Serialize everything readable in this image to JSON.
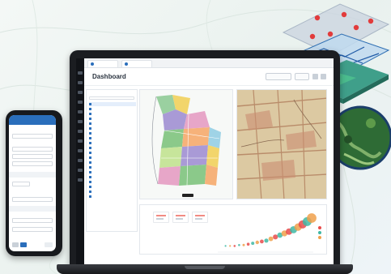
{
  "app": {
    "title": "Dashboard",
    "tabs": [
      "",
      ""
    ],
    "header_buttons": [
      "",
      ""
    ]
  },
  "layers_panel": {
    "title": "",
    "items": [
      "",
      "",
      "",
      "",
      "",
      "",
      "",
      "",
      "",
      "",
      "",
      "",
      "",
      "",
      "",
      "",
      "",
      "",
      "",
      ""
    ]
  },
  "chart": {
    "title": ""
  },
  "phone": {
    "title": "",
    "fields": [
      "",
      "",
      "",
      ""
    ],
    "sections": [
      "",
      ""
    ]
  },
  "colors": {
    "accent": "#2a6ebb",
    "rail": "#111317",
    "map_green": "#8bc98a",
    "map_purple": "#a99ad6",
    "map_yellow": "#f2d56b",
    "map_pink": "#e7a6c8",
    "historic": "#d9c8a4",
    "bubble_red": "#e84b4b",
    "bubble_teal": "#3fb8a5",
    "bubble_orange": "#f0a04b"
  },
  "chart_data": {
    "type": "scatter",
    "title": "",
    "xlabel": "",
    "ylabel": "",
    "series": [
      {
        "x": [
          1,
          2,
          3,
          4,
          5,
          6,
          7,
          8,
          9,
          10,
          11,
          12,
          13,
          14,
          15,
          16,
          17,
          18,
          19,
          20
        ],
        "y": [
          1,
          1,
          1,
          1.2,
          1.2,
          1.4,
          1.6,
          1.8,
          2.0,
          2.2,
          2.6,
          3.0,
          3.4,
          3.8,
          4.2,
          4.6,
          5.2,
          5.8,
          6.4,
          7.2
        ],
        "sizes": [
          1,
          1,
          1.2,
          1.2,
          1.4,
          1.6,
          1.8,
          2.0,
          2.2,
          2.4,
          2.6,
          2.8,
          3.0,
          3.4,
          3.6,
          4.0,
          4.2,
          4.6,
          5.0,
          5.4
        ]
      }
    ]
  }
}
